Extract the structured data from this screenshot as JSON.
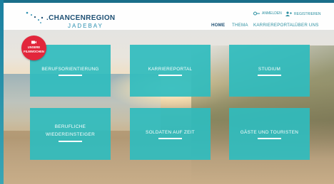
{
  "logo": {
    "main": ".CHANCENREGION",
    "sub": "JADEBAY"
  },
  "util_links": [
    {
      "label": "ANMELDEN",
      "icon": "key-icon"
    },
    {
      "label": "REGISTRIEREN",
      "icon": "user-plus-icon"
    }
  ],
  "nav": [
    {
      "label": "HOME",
      "active": true
    },
    {
      "label": "THEMA",
      "active": false
    },
    {
      "label": "KARRIEREPORTAL",
      "active": false
    },
    {
      "label": "ÜBER UNS",
      "active": false
    }
  ],
  "badge": {
    "line1": "UNSERE",
    "line2": "FILMWOCHEN",
    "icon": "film-icon"
  },
  "tiles": [
    {
      "line1": "BERUFSORIENTIERUNG",
      "line2": ""
    },
    {
      "line1": "KARRIEREPORTAL",
      "line2": ""
    },
    {
      "line1": "STUDIUM",
      "line2": ""
    },
    {
      "line1": "BERUFLICHE",
      "line2": "WIEDEREINSTEIGER"
    },
    {
      "line1": "SOLDATEN AUF ZEIT",
      "line2": ""
    },
    {
      "line1": "GÄSTE UND TOURISTEN",
      "line2": ""
    }
  ],
  "colors": {
    "tile": "#2fbcbe",
    "nav_active": "#1d4f73",
    "nav": "#2a8fa0",
    "badge": "#e2263b"
  }
}
